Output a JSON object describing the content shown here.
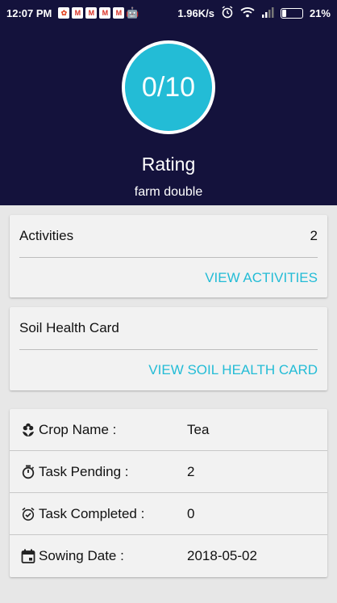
{
  "status_bar": {
    "time": "12:07 PM",
    "speed": "1.96K/s",
    "battery": "21%",
    "battery_level": 0.21
  },
  "header": {
    "rating": "0/10",
    "rating_label": "Rating",
    "farm_name": "farm double"
  },
  "activities": {
    "label": "Activities",
    "count": "2",
    "link": "VIEW ACTIVITIES"
  },
  "soil": {
    "label": "Soil Health Card",
    "link": "VIEW SOIL HEALTH CARD"
  },
  "details": {
    "crop": {
      "label": "Crop Name :",
      "value": "Tea",
      "icon": "flower-icon"
    },
    "pending": {
      "label": "Task Pending :",
      "value": "2",
      "icon": "timer-icon"
    },
    "completed": {
      "label": "Task Completed :",
      "value": "0",
      "icon": "alarm-check-icon"
    },
    "sowing": {
      "label": "Sowing Date :",
      "value": "2018-05-02",
      "icon": "calendar-icon"
    }
  },
  "colors": {
    "header_bg": "#14123c",
    "accent": "#23bcd6"
  }
}
